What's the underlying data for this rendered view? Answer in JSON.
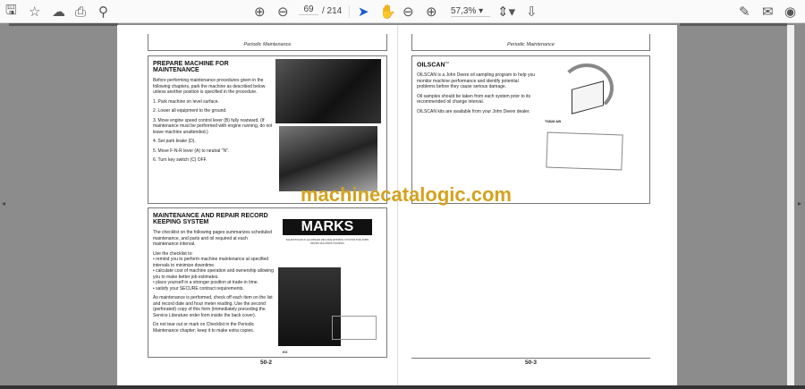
{
  "toolbar": {
    "page_current": "69",
    "page_total": "/ 214",
    "zoom": "57,3%",
    "icons": [
      "save-icon",
      "bookmark-star-icon",
      "upload-cloud-icon",
      "print-icon",
      "search-zoom-icon",
      "page-up-icon",
      "page-down-icon",
      "select-cursor-icon",
      "hand-pan-icon",
      "zoom-out-icon",
      "zoom-in-icon",
      "fit-page-icon",
      "read-mode-icon",
      "sign-icon",
      "mail-icon",
      "account-icon"
    ]
  },
  "watermark": "machinecatalogic.com",
  "left_page": {
    "header": "Periodic Maintenance",
    "prepare": {
      "title": "PREPARE MACHINE FOR MAINTENANCE",
      "intro": "Before performing maintenance procedures given in the following chapters, park the machine as described below unless another position is specified in the procedure.",
      "steps": [
        "1. Park machine on level surface.",
        "2. Lower all equipment to the ground.",
        "3. Move engine speed control lever (B) fully rearward. (If maintenance must be performed with engine running, do not leave machine unattended.)",
        "4. Set park brake (D).",
        "5. Move F-N-R lever (A) to neutral \"N\".",
        "6. Turn key switch (C) OFF."
      ]
    },
    "record": {
      "title": "MAINTENANCE AND REPAIR RECORD KEEPING SYSTEM",
      "intro": "The checklist on the following pages summarizes scheduled maintenance, and parts and oil required at each maintenance interval.",
      "use_label": "Use the checklist to:",
      "bullets": [
        "remind you to perform machine maintenance at specified intervals to minimize downtime.",
        "calculate cost of machine operation and ownership allowing you to make better job estimates.",
        "place yourself in a stronger position at trade-in time.",
        "satisfy your SECURE contract requirements."
      ],
      "para2": "As maintenance is performed, check off each item on the list and record date and hour meter reading. Use the second (perforated) copy of this form (immediately preceding the Service Literature order form inside the back cover).",
      "para3": "Do not tear out or mark on Checklist in the Periodic Maintenance chapter; keep it to make extra copies.",
      "logo": "MARKS",
      "logo_sub": "MAINTENANCE and REPAIR RECORD KEEPING SYSTEM FOR JOHN DEERE MACHINE OWNERS",
      "fig": "KX"
    },
    "page_number": "50-2"
  },
  "right_page": {
    "header": "Periodic Maintenance",
    "oilscan": {
      "title": "OILSCAN",
      "tm": "TM",
      "paras": [
        "OILSCAN is a John Deere oil sampling program to help you monitor machine performance and identify potential problems before they cause serious damage.",
        "Oil samples should be taken from each system prior to its recommended oil change interval.",
        "OILSCAN kits are available from your John Deere dealer."
      ],
      "fig": "T6828 AB"
    },
    "page_number": "50-3"
  }
}
